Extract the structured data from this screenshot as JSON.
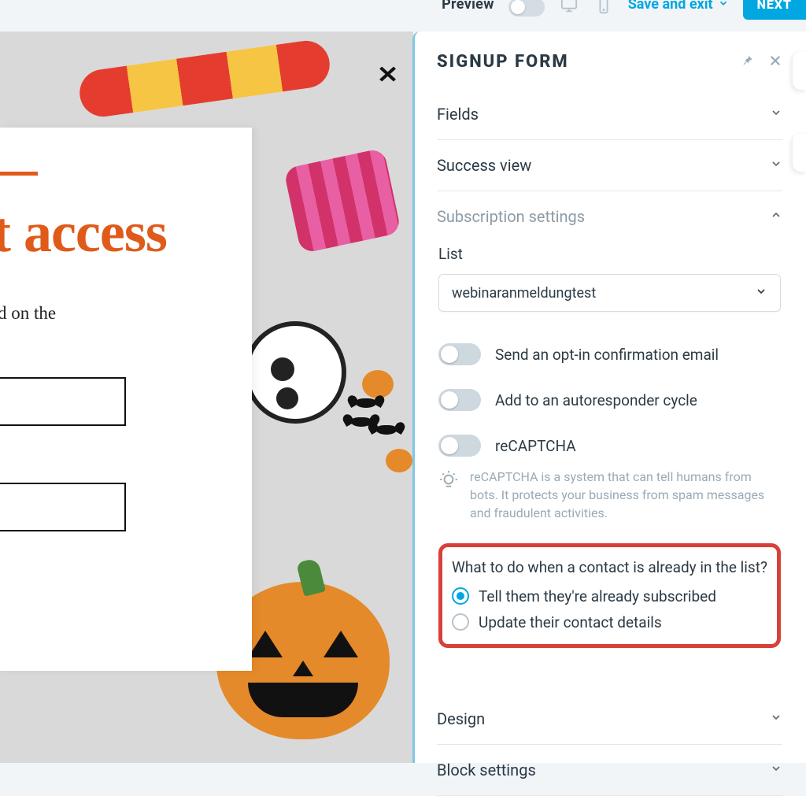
{
  "topbar": {
    "preview_label": "Preview",
    "save_exit_label": "Save and exit",
    "next_label": "NEXT"
  },
  "popup": {
    "title_fragment": "t access",
    "body_fragment": "sitors. You can build on the"
  },
  "panel": {
    "title": "SIGNUP FORM",
    "sections": {
      "fields": "Fields",
      "success_view": "Success view",
      "subscription_settings": "Subscription settings",
      "design": "Design",
      "block_settings": "Block settings"
    },
    "subscription": {
      "list_label": "List",
      "list_value": "webinaranmeldungtest",
      "opt_in_label": "Send an opt-in confirmation email",
      "autoresponder_label": "Add to an autoresponder cycle",
      "recaptcha_label": "reCAPTCHA",
      "recaptcha_hint": "reCAPTCHA is a system that can tell humans from bots. It protects your business from spam messages and fraudulent activities.",
      "dup_question": "What to do when a contact is already in the list?",
      "dup_option_a": "Tell them they're already subscribed",
      "dup_option_b": "Update their contact details",
      "dup_selected": "a"
    }
  }
}
